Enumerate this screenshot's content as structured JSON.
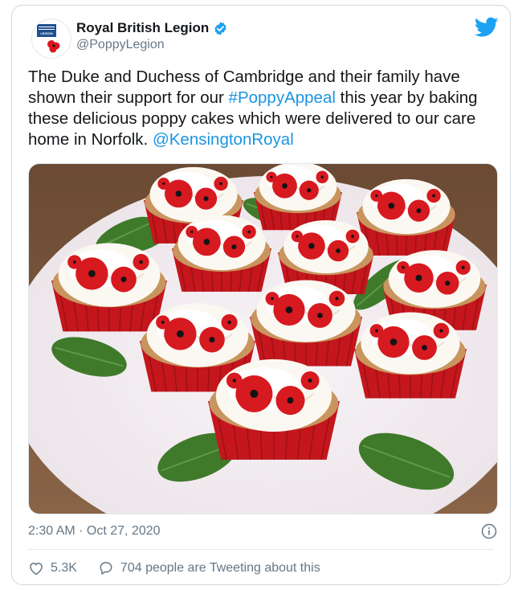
{
  "author": {
    "name": "Royal British Legion",
    "handle": "@PoppyLegion",
    "avatar_logo_text": "LEGION",
    "verified": true
  },
  "tweet": {
    "text_1": "The Duke and Duchess of Cambridge and their family have shown their support for our ",
    "hashtag": "#PoppyAppeal",
    "text_2": " this year by baking these delicious poppy cakes which were delivered to our care home in Norfolk. ",
    "mention": "@KensingtonRoyal",
    "timestamp": "2:30 AM · Oct 27, 2020"
  },
  "actions": {
    "likes": "5.3K",
    "conversation": "704 people are Tweeting about this"
  },
  "colors": {
    "link": "#1b95e0",
    "secondary_text": "#657786",
    "twitter_blue": "#1da1f2",
    "border": "#e1e8ed"
  },
  "icons": [
    "twitter-bird-icon",
    "verified-badge-icon",
    "info-icon",
    "heart-icon",
    "speech-bubble-icon"
  ]
}
